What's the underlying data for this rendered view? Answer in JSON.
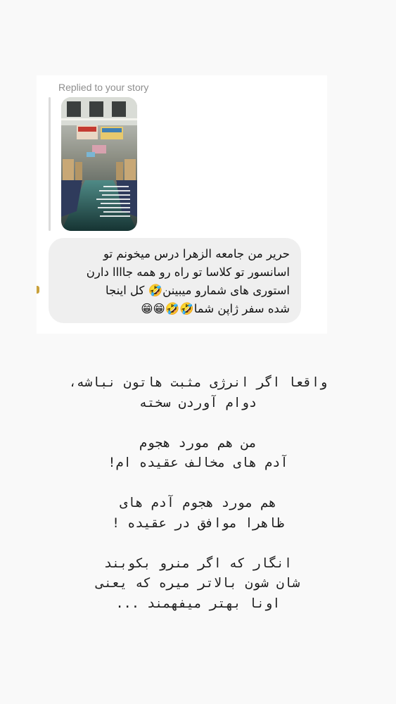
{
  "dm": {
    "reply_label": "Replied to your story",
    "message_lines": [
      "حریر من جامعه الزهرا درس میخونم تو",
      "اسانسور تو کلاسا تو راه رو همه جاااا دارن",
      "استوری های شمارو میبینن🤣 کل اینجا",
      "شده سفر ژاپن شما🤣🤣😁😁"
    ]
  },
  "story_caption": {
    "lines": [
      "واقعا اگر انرژی مثبت هاتون نباشه،",
      "دوام آوردن سخته",
      "",
      "من هم مورد هجوم",
      "آدم های مخالف عقیده ام!",
      "",
      "هم مورد هجوم آدم های",
      "ظاهرا موافق در عقیده !",
      "",
      "انگار که اگر منرو بکوبند",
      "شان شون بالاتر میره که یعنی",
      "اونا بهتر میفهمند ..."
    ]
  },
  "colors": {
    "background": "#f9f9f9",
    "card": "#ffffff",
    "bubble": "#efefef",
    "secondary_text": "#8e8e8e"
  }
}
